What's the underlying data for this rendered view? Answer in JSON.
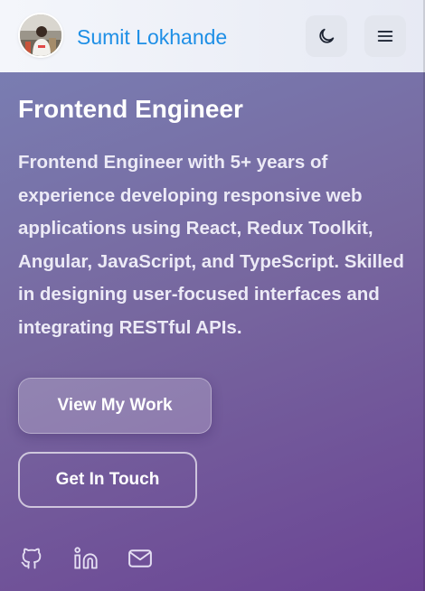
{
  "header": {
    "avatar_icon": "profile-photo",
    "brand_name": "Sumit Lokhande",
    "theme_toggle_icon": "moon-icon",
    "menu_icon": "hamburger-menu-icon"
  },
  "hero": {
    "title": "Frontend Engineer",
    "description": "Frontend Engineer with 5+ years of experience developing responsive web applications using React, Redux Toolkit, Angular, JavaScript, and TypeScript. Skilled in designing user-focused interfaces and integrating RESTful APIs.",
    "primary_button_label": "View My Work",
    "secondary_button_label": "Get In Touch"
  },
  "social": {
    "icons": [
      "github-icon",
      "linkedin-icon",
      "mail-icon"
    ]
  },
  "colors": {
    "brand": "#1e8fe6",
    "header_bg": "#eef0f7",
    "gradient_start": "#7a82b6",
    "gradient_end": "#6b4494",
    "text_light": "#ffffff"
  }
}
